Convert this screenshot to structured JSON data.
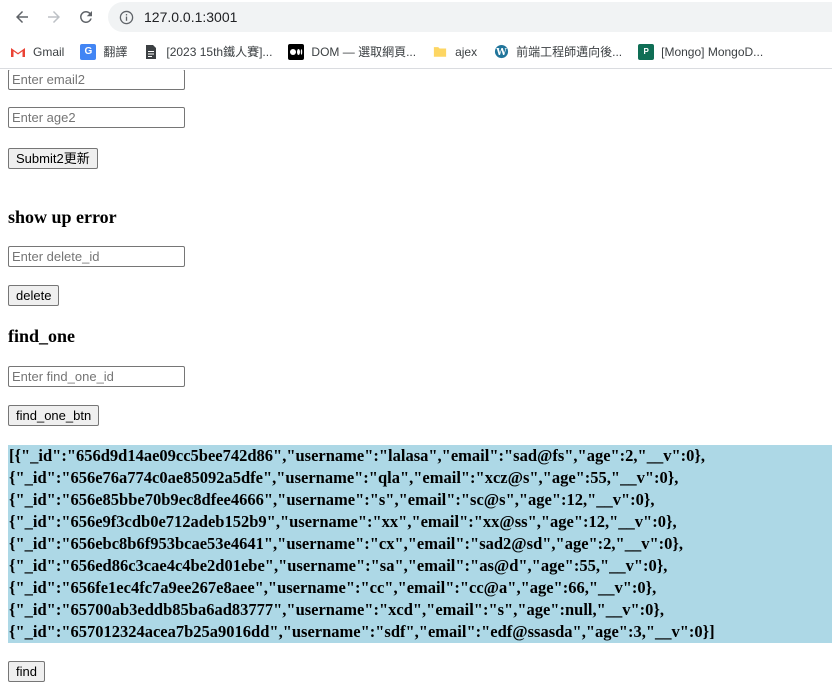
{
  "browser": {
    "url": "127.0.0.1:3001",
    "bookmarks": [
      {
        "label": "Gmail",
        "icon": "gmail-icon"
      },
      {
        "label": "翻譯",
        "icon": "translate-icon"
      },
      {
        "label": "[2023 15th鐵人賽]...",
        "icon": "document-icon"
      },
      {
        "label": "DOM — 選取網頁...",
        "icon": "medium-icon"
      },
      {
        "label": "ajex",
        "icon": "folder-icon"
      },
      {
        "label": "前端工程師邁向後...",
        "icon": "wordpress-icon"
      },
      {
        "label": "[Mongo] MongoD...",
        "icon": "site-icon"
      }
    ]
  },
  "form_update": {
    "email_placeholder": "Enter email2",
    "age_placeholder": "Enter age2",
    "submit_label": "Submit2更新"
  },
  "delete_section": {
    "heading": "show up error",
    "id_placeholder": "Enter delete_id",
    "button_label": "delete"
  },
  "find_one_section": {
    "heading": "find_one",
    "id_placeholder": "Enter find_one_id",
    "button_label": "find_one_btn"
  },
  "result_lines": [
    "[{\"_id\":\"656d9d14ae09cc5bee742d86\",\"username\":\"lalasa\",\"email\":\"sad@fs\",\"age\":2,\"__v\":0},",
    "{\"_id\":\"656e76a774c0ae85092a5dfe\",\"username\":\"qla\",\"email\":\"xcz@s\",\"age\":55,\"__v\":0},",
    "{\"_id\":\"656e85bbe70b9ec8dfee4666\",\"username\":\"s\",\"email\":\"sc@s\",\"age\":12,\"__v\":0},",
    "{\"_id\":\"656e9f3cdb0e712adeb152b9\",\"username\":\"xx\",\"email\":\"xx@ss\",\"age\":12,\"__v\":0},",
    "{\"_id\":\"656ebc8b6f953bcae53e4641\",\"username\":\"cx\",\"email\":\"sad2@sd\",\"age\":2,\"__v\":0},",
    "{\"_id\":\"656ed86c3cae4c4be2d01ebe\",\"username\":\"sa\",\"email\":\"as@d\",\"age\":55,\"__v\":0},",
    "{\"_id\":\"656fe1ec4fc7a9ee267e8aee\",\"username\":\"cc\",\"email\":\"cc@a\",\"age\":66,\"__v\":0},",
    "{\"_id\":\"65700ab3eddb85ba6ad83777\",\"username\":\"xcd\",\"email\":\"s\",\"age\":null,\"__v\":0},",
    "{\"_id\":\"657012324acea7b25a9016dd\",\"username\":\"sdf\",\"email\":\"edf@ssasda\",\"age\":3,\"__v\":0}]"
  ],
  "find_button_label": "find",
  "colors": {
    "result_background": "#add8e6",
    "omnibox_background": "#f1f3f4"
  }
}
